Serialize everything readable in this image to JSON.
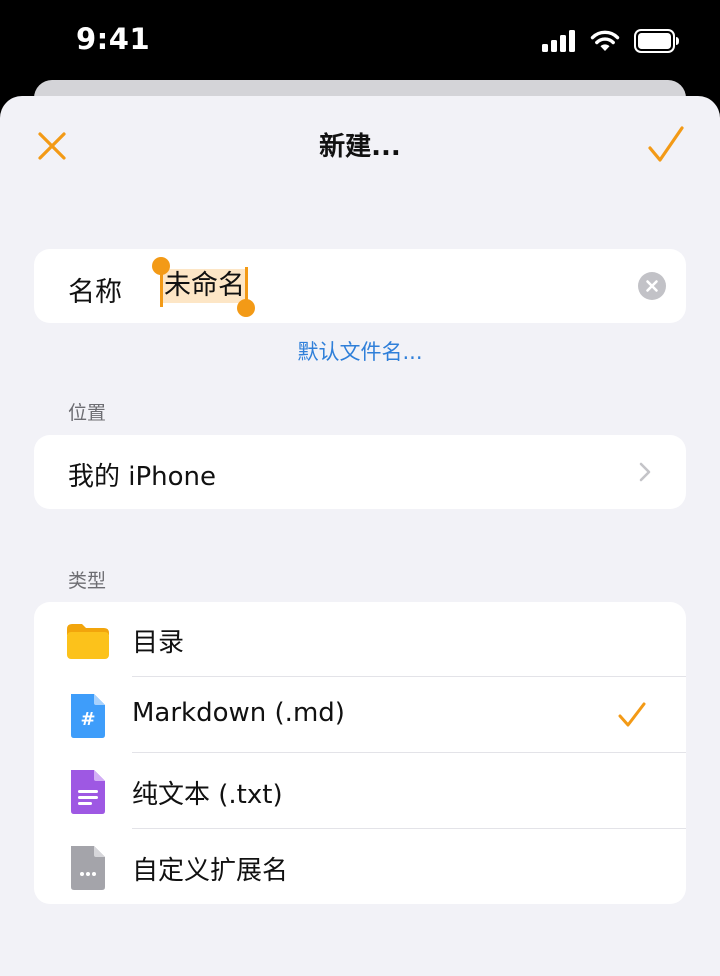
{
  "status_bar": {
    "time": "9:41",
    "icons": [
      "cellular-signal-icon",
      "wifi-icon",
      "battery-icon"
    ]
  },
  "sheet": {
    "title": "新建...",
    "close_icon": "close-icon",
    "done_icon": "checkmark-icon",
    "accent_color": "#f39a16"
  },
  "name_field": {
    "label": "名称",
    "value": "未命名",
    "clear_icon": "clear-icon"
  },
  "default_name_link": "默认文件名...",
  "location": {
    "header": "位置",
    "value": "我的 iPhone",
    "chevron_icon": "chevron-right-icon"
  },
  "type": {
    "header": "类型",
    "options": [
      {
        "label": "目录",
        "icon": "folder-icon",
        "selected": false
      },
      {
        "label": "Markdown (.md)",
        "icon": "markdown-file-icon",
        "selected": true
      },
      {
        "label": "纯文本 (.txt)",
        "icon": "text-file-icon",
        "selected": false
      },
      {
        "label": "自定义扩展名",
        "icon": "custom-file-icon",
        "selected": false
      }
    ]
  }
}
